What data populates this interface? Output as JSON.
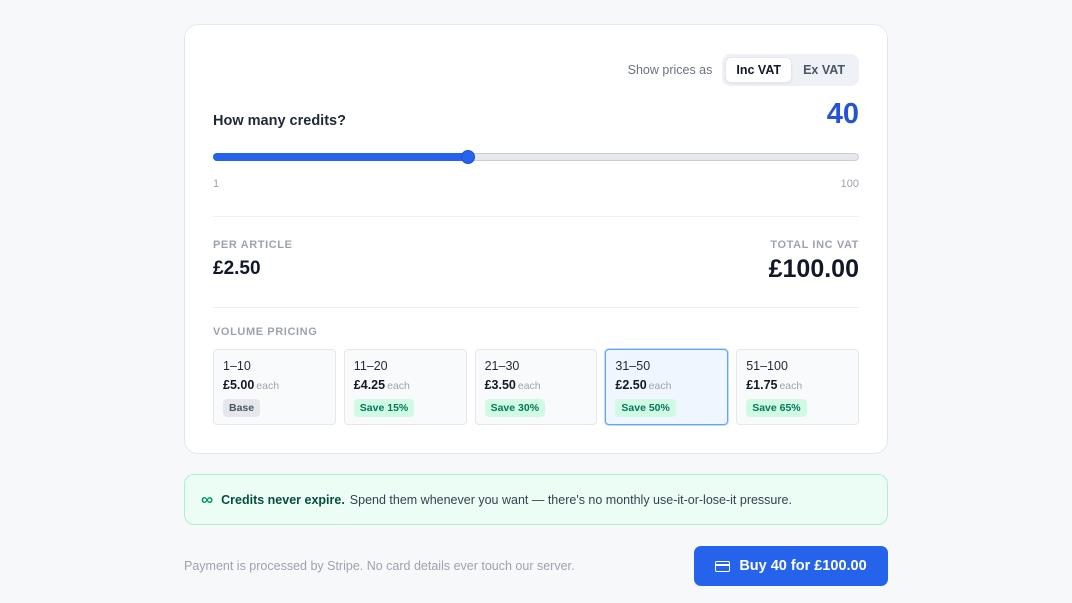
{
  "vat": {
    "label": "Show prices as",
    "options": [
      "Inc VAT",
      "Ex VAT"
    ],
    "selected": "Inc VAT"
  },
  "quantity": {
    "label": "How many credits?",
    "value": "40",
    "min_label": "1",
    "max_label": "100",
    "slider_min": 1,
    "slider_max": 100,
    "slider_value": 40
  },
  "summary": {
    "per_label": "PER ARTICLE",
    "per_value": "£2.50",
    "total_label": "TOTAL INC VAT",
    "total_value": "£100.00"
  },
  "volume": {
    "title": "VOLUME PRICING",
    "tiers": [
      {
        "range": "1–10",
        "price": "£5.00",
        "each": "each",
        "badge": "Base",
        "badge_type": "base"
      },
      {
        "range": "11–20",
        "price": "£4.25",
        "each": "each",
        "badge": "Save 15%",
        "badge_type": "save"
      },
      {
        "range": "21–30",
        "price": "£3.50",
        "each": "each",
        "badge": "Save 30%",
        "badge_type": "save"
      },
      {
        "range": "31–50",
        "price": "£2.50",
        "each": "each",
        "badge": "Save 50%",
        "badge_type": "save",
        "selected": true
      },
      {
        "range": "51–100",
        "price": "£1.75",
        "each": "each",
        "badge": "Save 65%",
        "badge_type": "save"
      }
    ]
  },
  "notice": {
    "icon": "infinity-icon",
    "strong": "Credits never expire.",
    "text": "Spend them whenever you want — there's no monthly use-it-or-lose-it pressure."
  },
  "footer": {
    "text": "Payment is processed by Stripe. No card details ever touch our server.",
    "buy_label": "Buy 40 for £100.00",
    "buy_icon": "credit-card-icon"
  },
  "colors": {
    "accent": "#2563eb",
    "success": "#059669"
  }
}
